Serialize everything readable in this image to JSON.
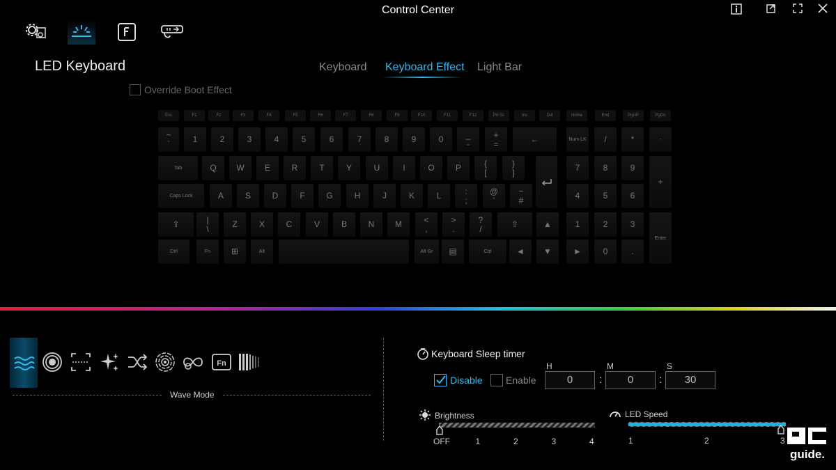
{
  "app": {
    "title": "Control Center"
  },
  "window_controls": [
    "info-icon",
    "restore-icon",
    "fullscreen-icon",
    "close-icon"
  ],
  "nav_tabs": [
    {
      "name": "settings-gear-icon",
      "active": false
    },
    {
      "name": "led-light-icon",
      "active": true
    },
    {
      "name": "fn-key-icon",
      "active": false
    },
    {
      "name": "usb-connection-icon",
      "active": false
    }
  ],
  "page": {
    "title": "LED Keyboard"
  },
  "sub_tabs": [
    {
      "label": "Keyboard",
      "active": false
    },
    {
      "label": "Keyboard Effect",
      "active": true
    },
    {
      "label": "Light Bar",
      "active": false
    }
  ],
  "override": {
    "label": "Override Boot Effect",
    "checked": false
  },
  "keyboard": {
    "fkeys": [
      "Esc",
      "F1",
      "F2",
      "F3",
      "F4",
      "F5",
      "F6",
      "F7",
      "F8",
      "F9",
      "F10",
      "F11",
      "F12",
      "Prt Sc",
      "Ins",
      "Del",
      "Home",
      "End",
      "PgUP",
      "PgDn"
    ],
    "row1": [
      "~\n`",
      "1",
      "2",
      "3",
      "4",
      "5",
      "6",
      "7",
      "8",
      "9",
      "0",
      "_\n-",
      "+\n=",
      "←"
    ],
    "row2": [
      "Tab",
      "Q",
      "W",
      "E",
      "R",
      "T",
      "Y",
      "U",
      "I",
      "O",
      "P",
      "{\n[",
      "}\n]"
    ],
    "row3": [
      "Caps Lock",
      "A",
      "S",
      "D",
      "F",
      "G",
      "H",
      "J",
      "K",
      "L",
      ":\n;",
      "@\n'",
      "~\n#"
    ],
    "row4": [
      "⇧",
      "|\n\\",
      "Z",
      "X",
      "C",
      "V",
      "B",
      "N",
      "M",
      "<\n,",
      ">\n.",
      "?\n/",
      "⇧",
      "▲"
    ],
    "row5": [
      "Ctrl",
      "Fn",
      "⊞",
      "Alt",
      "",
      "Alt Gr",
      "▤",
      "Ctrl",
      "◄",
      "▼",
      "►"
    ],
    "numpad_row1": [
      "Num LK",
      "/",
      "*",
      "-"
    ],
    "numpad_row2": [
      "7",
      "8",
      "9",
      "+"
    ],
    "numpad_row3": [
      "4",
      "5",
      "6"
    ],
    "numpad_row4": [
      "1",
      "2",
      "3",
      "Enter"
    ],
    "numpad_row5": [
      "0",
      "."
    ]
  },
  "effects": {
    "icons": [
      "wave-icon",
      "breathing-icon",
      "scan-icon",
      "sparkle-icon",
      "random-icon",
      "ripple-icon",
      "infinity-icon",
      "fn-icon",
      "bars-icon"
    ],
    "selected_label": "Wave Mode"
  },
  "sleep_timer": {
    "title": "Keyboard Sleep timer",
    "disable_label": "Disable",
    "enable_label": "Enable",
    "disable_checked": true,
    "h_label": "H",
    "m_label": "M",
    "s_label": "S",
    "h_value": "0",
    "m_value": "0",
    "s_value": "30"
  },
  "brightness": {
    "label": "Brightness",
    "ticks": [
      "OFF",
      "1",
      "2",
      "3",
      "4"
    ],
    "value_index": 0
  },
  "led_speed": {
    "label": "LED Speed",
    "ticks": [
      "1",
      "2",
      "3"
    ],
    "value_index": 2
  },
  "watermark": "PC guide.",
  "colors": {
    "accent": "#2fb9ec",
    "background": "#000000"
  }
}
